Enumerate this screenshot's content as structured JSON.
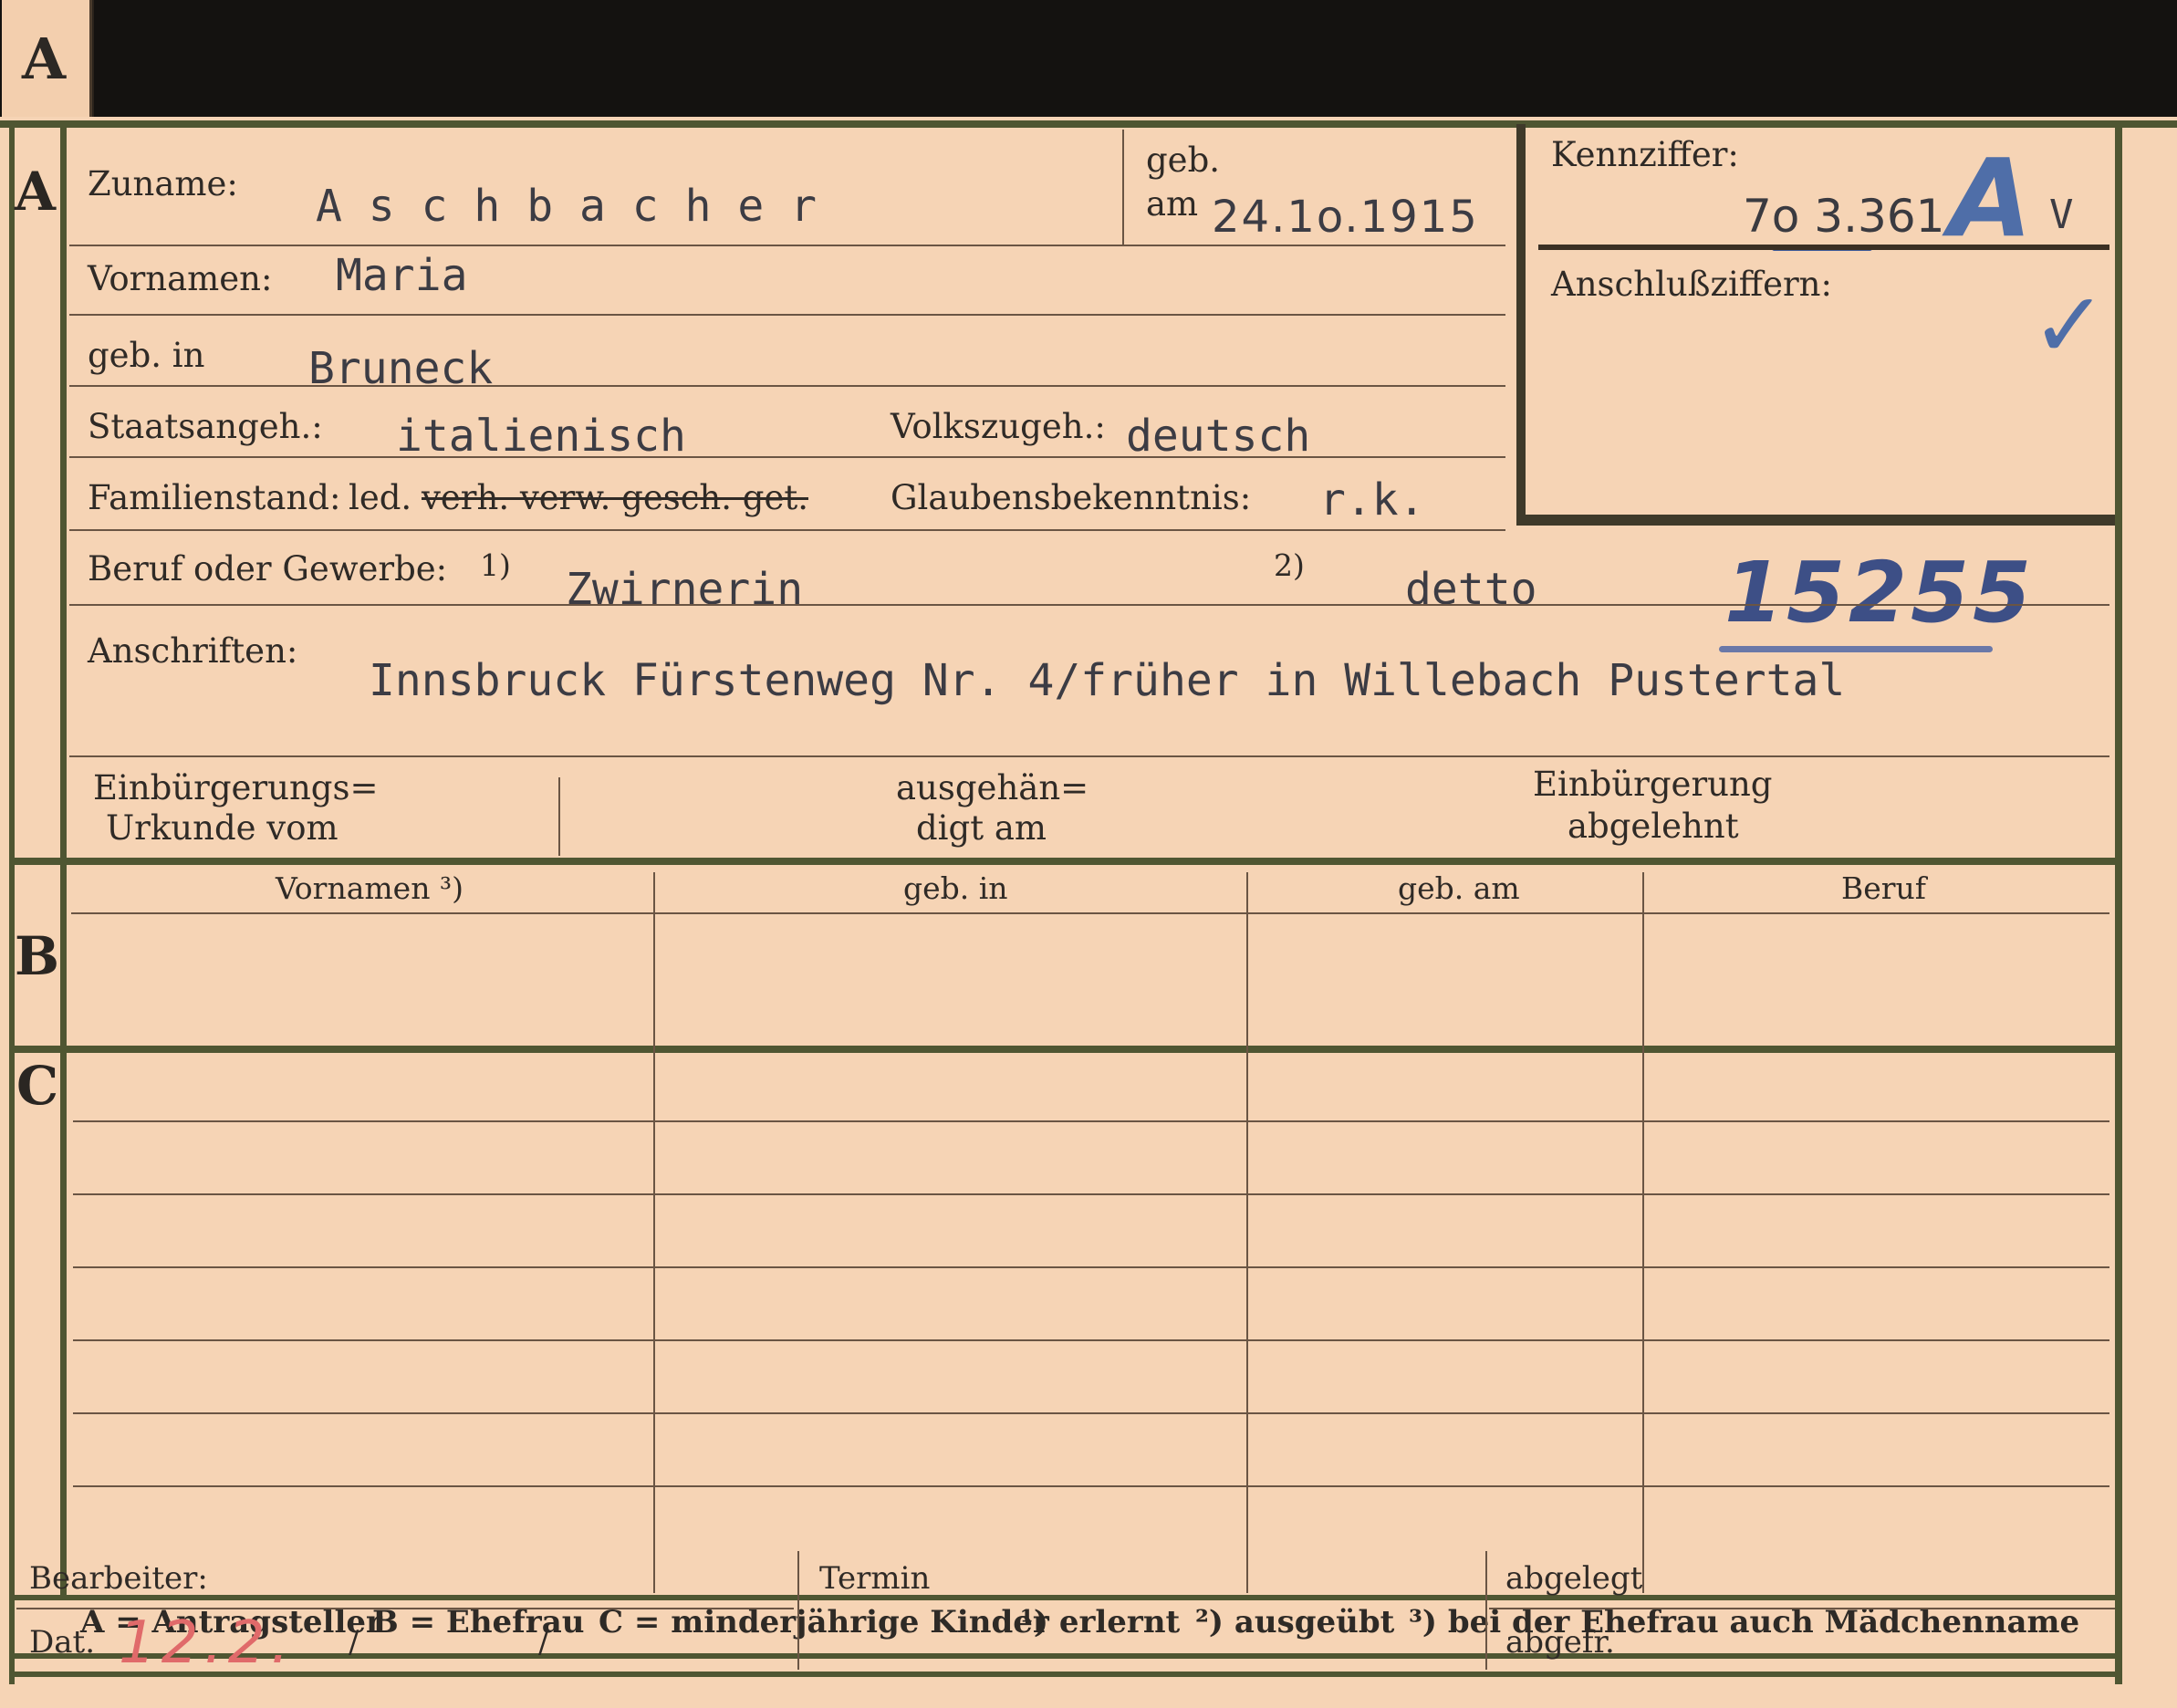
{
  "tab_letter": "A",
  "section_a": {
    "marker": "A",
    "surname_label": "Zuname:",
    "surname_value": "A s c h b a c h e r",
    "born_label_top": "geb.",
    "born_label_bottom": "am",
    "born_date": "24.1o.1915",
    "firstnames_label": "Vornamen:",
    "firstnames_value": "Maria",
    "birthplace_label": "geb. in",
    "birthplace_value": "Bruneck",
    "citizenship_label": "Staatsangeh.:",
    "citizenship_value": "italienisch",
    "ethnicity_label": "Volkszugeh.:",
    "ethnicity_value": "deutsch",
    "marital_label": "Familienstand:",
    "marital_options_kept": "led.",
    "marital_options_struck": "verh. verw. gesch. get.",
    "religion_label": "Glaubensbekenntnis:",
    "religion_value": "r.k.",
    "profession_label": "Beruf oder Gewerbe:",
    "profession_note1": "1)",
    "profession_learned": "Zwirnerin",
    "profession_note2": "2)",
    "profession_practiced": "detto",
    "case_number_hand": "15255",
    "addresses_label": "Anschriften:",
    "addresses_value": "Innsbruck Fürstenweg Nr. 4/früher in Willebach Pustertal",
    "natcert_label_1": "Einbürgerungs=",
    "natcert_label_2": "Urkunde vom",
    "handed_label_1": "ausgehän=",
    "handed_label_2": "digt am",
    "refused_label_1": "Einbürgerung",
    "refused_label_2": "abgelehnt"
  },
  "ident_box": {
    "kennziffer_label": "Kennziffer:",
    "kennziffer_value": "7o 3.361",
    "kennziffer_letter": "A",
    "kennziffer_suffix": "V",
    "anschluss_label": "Anschlußziffern:",
    "check_mark": "✓"
  },
  "section_b": {
    "marker": "B",
    "columns": [
      "Vornamen ³)",
      "geb. in",
      "geb. am",
      "Beruf"
    ]
  },
  "section_c": {
    "marker": "C"
  },
  "legend": {
    "a": "A = Antragsteller",
    "b": "B = Ehefrau",
    "c": "C = minderjährige Kinder",
    "n1": "¹) erlernt",
    "n2": "²) ausgeübt",
    "n3": "³) bei der Ehefrau auch Mädchenname"
  },
  "footer": {
    "bearbeiter_label": "Bearbeiter:",
    "dat_label": "Dat.",
    "dat_value": "12.2.",
    "slash1": "/",
    "slash2": "/",
    "termin_label": "Termin",
    "abgelegt_label": "abgelegt",
    "abgefr_label": "abgefr."
  },
  "colors": {
    "card": "#f6d4b5",
    "frame_green": "#4f5632",
    "ink_blue": "#4f6ea8",
    "ink_red": "#e06a6a"
  }
}
